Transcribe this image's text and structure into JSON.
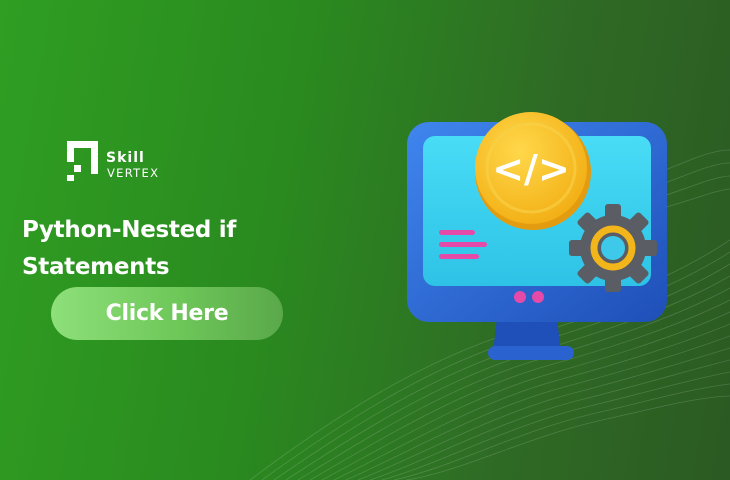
{
  "brand": {
    "name_top": "Skill",
    "name_bottom": "VERTEX"
  },
  "headline": {
    "line1": "Python-Nested if",
    "line2": "Statements"
  },
  "cta": {
    "label": "Click Here"
  },
  "illustration": {
    "badge_glyph": "</>",
    "icons": [
      "monitor-icon",
      "code-coin-icon",
      "gear-icon"
    ]
  },
  "colors": {
    "background_start": "#2f9e22",
    "background_end": "#2b5a22",
    "button": "#7bd165",
    "monitor": "#2f6fd6",
    "screen": "#3ed3f0",
    "coin": "#f7c21c",
    "gear": "#55585f",
    "accent_pink": "#e64aa8"
  }
}
